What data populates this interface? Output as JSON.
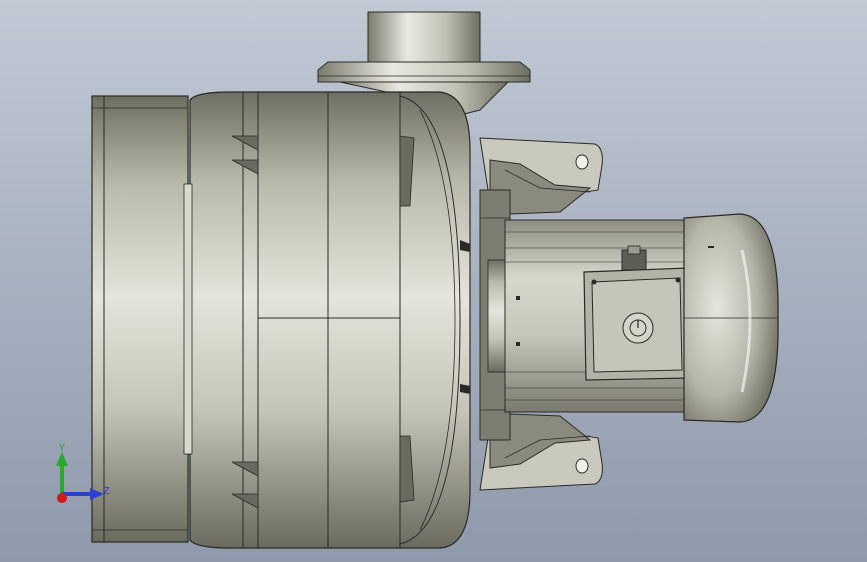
{
  "viewport": {
    "background_top": "#c2c9d5",
    "background_bottom": "#8e99ab",
    "model": "pump-with-motor"
  },
  "triad": {
    "y_label": "Y",
    "z_label": "Z",
    "y_color": "#2aa82a",
    "z_color": "#2b3fd1",
    "x_color": "#d11a1a"
  }
}
